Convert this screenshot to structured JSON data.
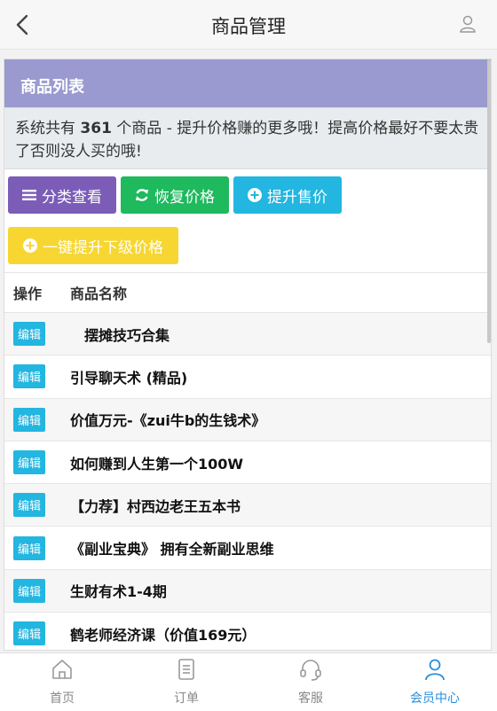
{
  "header": {
    "title": "商品管理",
    "back_icon": "chevron-left-icon",
    "user_icon": "user-icon"
  },
  "panel": {
    "title": "商品列表",
    "notice": {
      "prefix": "系统共有 ",
      "count": "361",
      "suffix": " 个商品 - 提升价格赚的更多哦！提高价格最好不要太贵了否则没人买的哦!"
    }
  },
  "buttons": {
    "category": "分类查看",
    "restore": "恢复价格",
    "raise": "提升售价",
    "raise_all": "一键提升下级价格"
  },
  "colors": {
    "panel_head": "#9a9ad0",
    "btn_category": "#7b5db8",
    "btn_restore": "#1fb95e",
    "btn_raise": "#22b6e0",
    "btn_raise_all": "#f7d631",
    "tab_active": "#2a8fdc"
  },
  "table": {
    "headers": [
      "操作",
      "商品名称"
    ],
    "edit_label": "编辑",
    "rows": [
      "　摆摊技巧合集",
      "引导聊天术 (精品)",
      "价值万元-《zui牛b的生钱术》",
      "如何赚到人生第一个100W",
      "【力荐】村西边老王五本书",
      "《副业宝典》 拥有全新副业思维",
      "生财有术1-4期",
      "鹤老师经济课（价值169元）"
    ]
  },
  "tabbar": {
    "items": [
      {
        "label": "首页",
        "icon": "home-icon",
        "active": false
      },
      {
        "label": "订单",
        "icon": "order-icon",
        "active": false
      },
      {
        "label": "客服",
        "icon": "headset-icon",
        "active": false
      },
      {
        "label": "会员中心",
        "icon": "user-icon",
        "active": true
      }
    ]
  }
}
